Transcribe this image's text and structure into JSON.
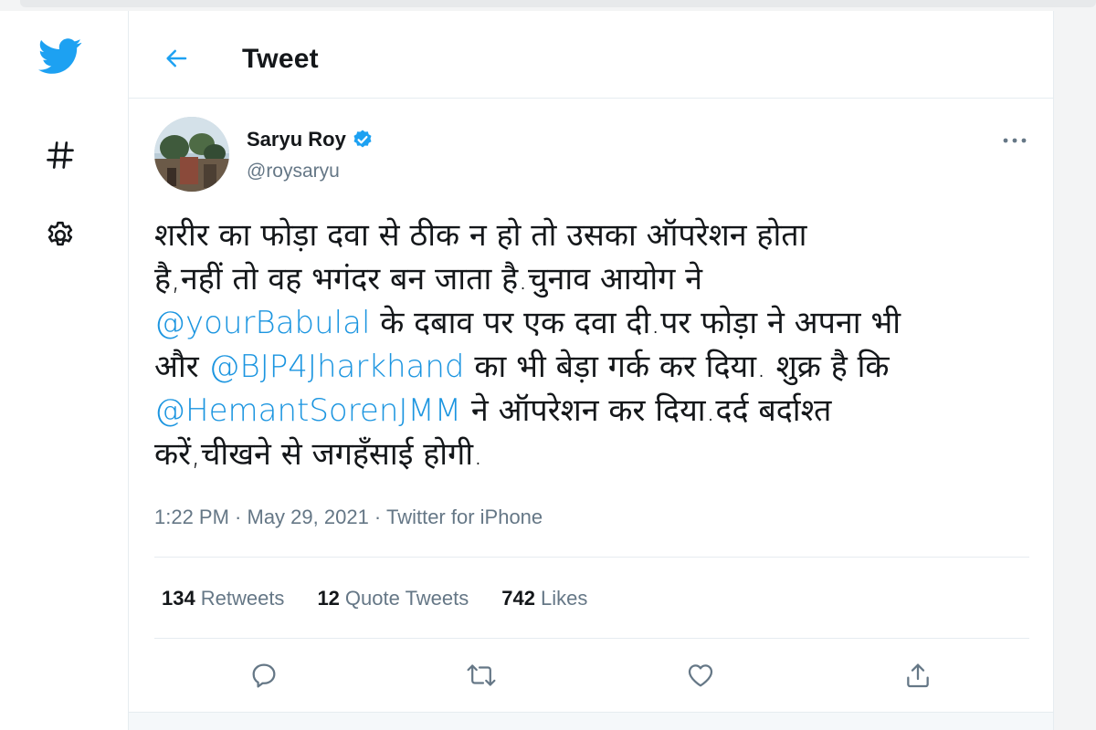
{
  "header": {
    "title": "Tweet"
  },
  "nav": {
    "logo_icon": "twitter-bird-icon",
    "explore_icon": "hashtag-icon",
    "settings_icon": "gear-icon"
  },
  "tweet": {
    "display_name": "Saryu Roy",
    "verified": true,
    "handle": "@roysaryu",
    "text_lines": [
      [
        {
          "t": "शरीर का फोड़ा दवा से ठीक न हो तो उसका ऑपरेशन होता",
          "m": false
        }
      ],
      [
        {
          "t": "है,नहीं तो वह भगंदर बन जाता है.चुनाव आयोग ने",
          "m": false
        }
      ],
      [
        {
          "t": "@yourBabulal",
          "m": true
        },
        {
          "t": " के दबाव पर एक दवा दी.पर फोड़ा ने अपना भी",
          "m": false
        }
      ],
      [
        {
          "t": "और ",
          "m": false
        },
        {
          "t": "@BJP4Jharkhand",
          "m": true
        },
        {
          "t": " का भी बेड़ा गर्क कर दिया. शुक्र है कि",
          "m": false
        }
      ],
      [
        {
          "t": "@HemantSorenJMM",
          "m": true
        },
        {
          "t": " ने ऑपरेशन कर दिया.दर्द बर्दाश्त",
          "m": false
        }
      ],
      [
        {
          "t": "करें,चीखने से जगहँसाई होगी.",
          "m": false
        }
      ]
    ],
    "time": "1:22 PM",
    "date": "May 29, 2021",
    "source": "Twitter for iPhone",
    "separator": " · "
  },
  "stats": {
    "retweets": {
      "count": "134",
      "label": "Retweets"
    },
    "quotes": {
      "count": "12",
      "label": "Quote Tweets"
    },
    "likes": {
      "count": "742",
      "label": "Likes"
    }
  },
  "colors": {
    "accent": "#1da1f2",
    "mention": "#1b95e0",
    "muted": "#657786",
    "verified": "#1da1f2"
  }
}
